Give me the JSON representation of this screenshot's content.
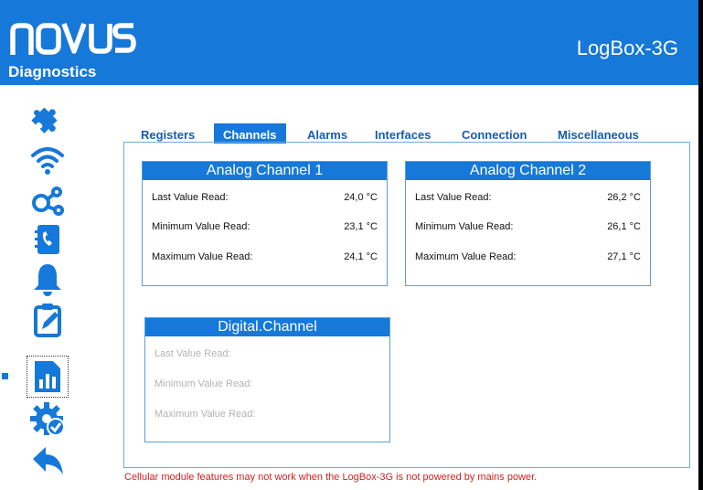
{
  "header": {
    "logo_text": "novus",
    "section_title": "Diagnostics",
    "device_name": "LogBox-3G",
    "background": "#1678d8"
  },
  "sidebar": {
    "items": [
      {
        "name": "puzzle-icon",
        "active": false
      },
      {
        "name": "wifi-icon",
        "active": false
      },
      {
        "name": "network-icon",
        "active": false
      },
      {
        "name": "phone-book-icon",
        "active": false
      },
      {
        "name": "bell-icon",
        "active": false
      },
      {
        "name": "clipboard-edit-icon",
        "active": false
      },
      {
        "name": "diagnostics-chart-icon",
        "active": true
      },
      {
        "name": "gear-check-icon",
        "active": false
      },
      {
        "name": "back-arrow-icon",
        "active": false
      }
    ]
  },
  "tabs": [
    {
      "label": "Registers",
      "active": false
    },
    {
      "label": "Channels",
      "active": true
    },
    {
      "label": "Alarms",
      "active": false
    },
    {
      "label": "Interfaces",
      "active": false
    },
    {
      "label": "Connection",
      "active": false
    },
    {
      "label": "Miscellaneous",
      "active": false
    }
  ],
  "panels": {
    "analog1": {
      "title": "Analog Channel 1",
      "rows": [
        {
          "label": "Last Value Read:",
          "value": "24,0 °C"
        },
        {
          "label": "Minimum Value Read:",
          "value": "23,1 °C"
        },
        {
          "label": "Maximum Value Read:",
          "value": "24,1 °C"
        }
      ]
    },
    "analog2": {
      "title": "Analog Channel 2",
      "rows": [
        {
          "label": "Last Value Read:",
          "value": "26,2 °C"
        },
        {
          "label": "Minimum Value Read:",
          "value": "26,1 °C"
        },
        {
          "label": "Maximum Value Read:",
          "value": "27,1 °C"
        }
      ]
    },
    "digital": {
      "title": "Digital.Channel",
      "disabled": true,
      "rows": [
        {
          "label": "Last Value Read:",
          "value": ""
        },
        {
          "label": "Minimum Value Read:",
          "value": ""
        },
        {
          "label": "Maximum Value Read:",
          "value": ""
        }
      ]
    }
  },
  "footer": {
    "note": "Cellular module features may not work when the LogBox-3G is not powered by mains power.",
    "note_color": "#d42020"
  },
  "colors": {
    "accent": "#1678d8",
    "tab_text": "#1a5da8",
    "border": "#5a9fe0"
  }
}
